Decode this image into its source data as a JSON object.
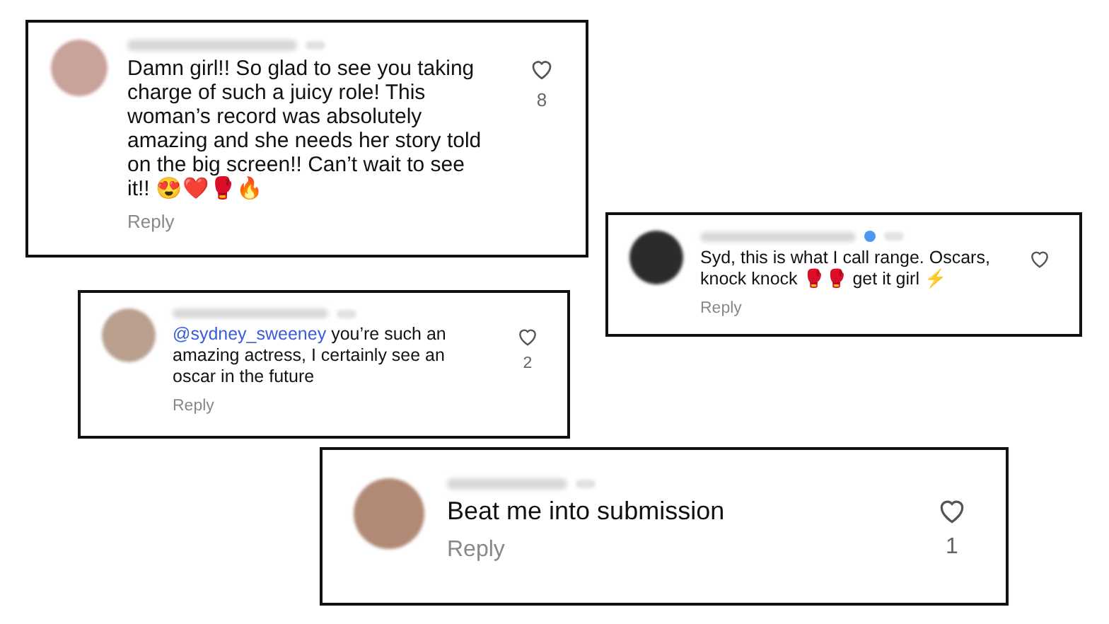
{
  "comments": [
    {
      "kind": "medium",
      "verified": false,
      "text": "Damn girl!! So glad to see you taking charge of such a juicy role! This woman’s record was absolutely amazing and she needs her story told on the big screen!! Can’t wait to see it!! 😍❤️🥊🔥",
      "likes": "8",
      "reply": "Reply"
    },
    {
      "kind": "small",
      "verified": true,
      "text": "Syd, this is what I call range. Oscars, knock knock 🥊🥊 get it girl ⚡",
      "reply": "Reply"
    },
    {
      "kind": "small",
      "verified": false,
      "mention": "@sydney_sweeney",
      "text": " you’re such an amazing actress, I certainly see an oscar in the future",
      "likes": "2",
      "reply": "Reply"
    },
    {
      "kind": "large",
      "verified": false,
      "text": "Beat me into submission",
      "likes": "1",
      "reply": "Reply"
    }
  ]
}
